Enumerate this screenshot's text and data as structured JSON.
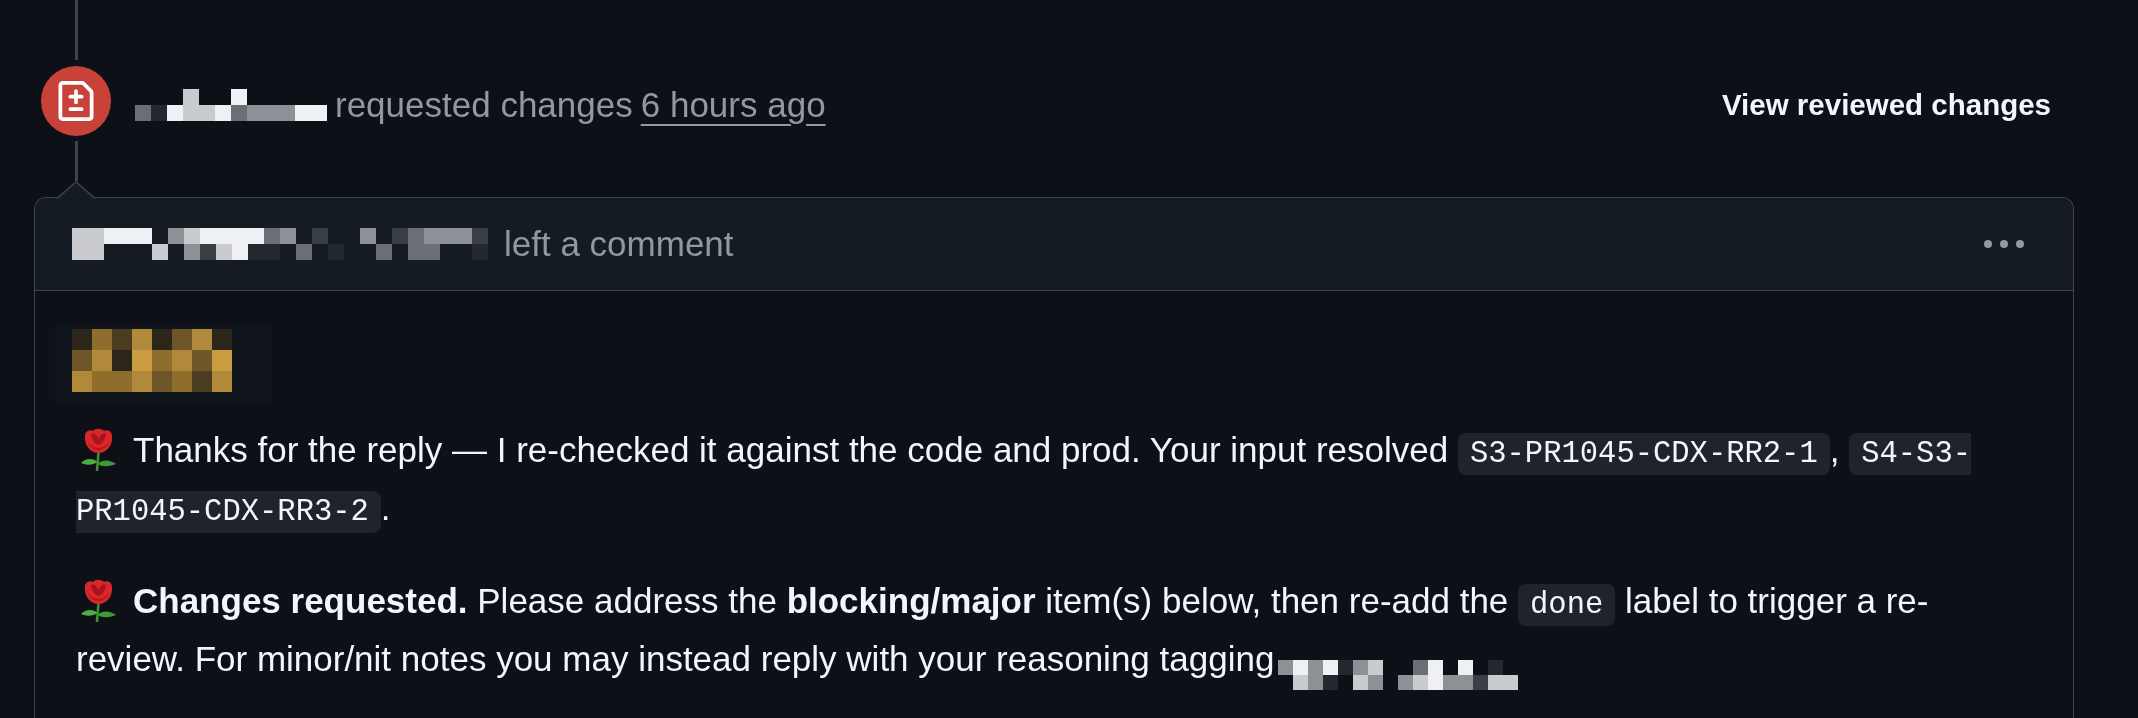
{
  "timeline_event": {
    "actor": {
      "redacted": true
    },
    "action": "requested changes",
    "time": "6 hours ago",
    "link": "View reviewed changes"
  },
  "comment": {
    "author": {
      "redacted": true
    },
    "action": "left a comment",
    "body": [
      {
        "kind": "redacted"
      },
      {
        "kind": "paragraph",
        "segments": [
          {
            "kind": "emoji"
          },
          {
            "kind": "text",
            "text": "Thanks for the reply — I re-checked it against the code and prod. Your input resolved "
          },
          {
            "kind": "code",
            "text": "S3-PR1045-CDX-RR2-1"
          },
          {
            "kind": "text",
            "text": ", "
          },
          {
            "kind": "code",
            "text": "S4-S3-PR1045-CDX-RR3-2"
          },
          {
            "kind": "text",
            "text": "."
          }
        ]
      },
      {
        "kind": "paragraph",
        "segments": [
          {
            "kind": "emoji"
          },
          {
            "kind": "text",
            "text": "**Changes requested.** Please address the **blocking/major** item(s) below, then re-add the "
          },
          {
            "kind": "code",
            "text": "done"
          },
          {
            "kind": "text",
            "text": " label to trigger a re-review. For minor/nit notes you may instead reply with your reasoning tagging"
          },
          {
            "kind": "redacted"
          }
        ]
      }
    ]
  }
}
